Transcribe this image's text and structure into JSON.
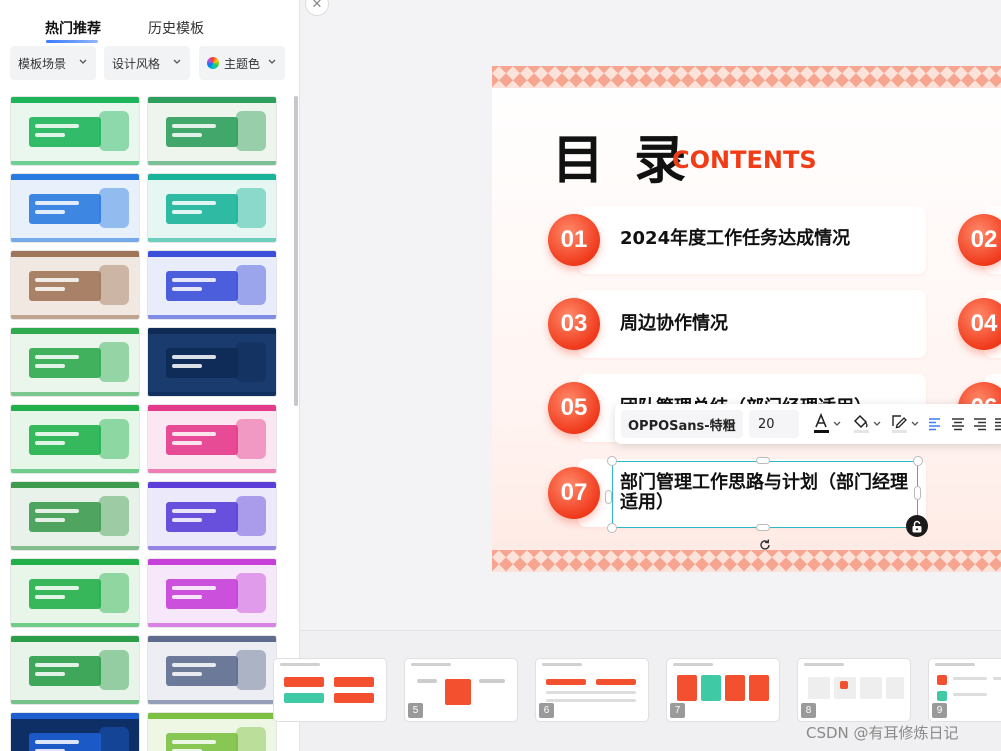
{
  "left_panel": {
    "tabs": [
      {
        "label": "热门推荐",
        "active": true
      },
      {
        "label": "历史模板",
        "active": false
      }
    ],
    "filters": [
      {
        "label": "模板场景"
      },
      {
        "label": "设计风格"
      },
      {
        "label": "主题色"
      }
    ],
    "templates": [
      {
        "c1": "#1eb45a",
        "c2": "#e9f7ee"
      },
      {
        "c1": "#2e9f5c",
        "c2": "#eef5ec"
      },
      {
        "c1": "#2a7be0",
        "c2": "#e7f0fb"
      },
      {
        "c1": "#1bb39a",
        "c2": "#e6f7f3"
      },
      {
        "c1": "#a0765a",
        "c2": "#f1e9e1"
      },
      {
        "c1": "#3b4fd8",
        "c2": "#e9ecfb"
      },
      {
        "c1": "#2faa4f",
        "c2": "#eaf6ec"
      },
      {
        "c1": "#0e2a55",
        "c2": "#1a3b6e"
      },
      {
        "c1": "#22b04c",
        "c2": "#e6f7ea"
      },
      {
        "c1": "#e53a8c",
        "c2": "#fbe7f1"
      },
      {
        "c1": "#3e9b50",
        "c2": "#e9f2ea"
      },
      {
        "c1": "#5b3fd8",
        "c2": "#ece9fb"
      },
      {
        "c1": "#23b04a",
        "c2": "#e7f6e9"
      },
      {
        "c1": "#c63fd8",
        "c2": "#f6e7fa"
      },
      {
        "c1": "#2c9e49",
        "c2": "#e8f4ea"
      },
      {
        "c1": "#5e6b8f",
        "c2": "#eceef3"
      },
      {
        "c1": "#1d5fd0",
        "c2": "#0e2e66"
      },
      {
        "c1": "#7cc142",
        "c2": "#eef7e4"
      }
    ]
  },
  "slide": {
    "title": "目 录",
    "subtitle": "CONTENTS",
    "items": [
      {
        "num": "01",
        "text": "2024年度工作任务达成情况"
      },
      {
        "num": "02",
        "text": ""
      },
      {
        "num": "03",
        "text": "周边协作情况"
      },
      {
        "num": "04",
        "text": ""
      },
      {
        "num": "05",
        "text": "团队管理总结（部门经理适用）"
      },
      {
        "num": "06",
        "text": ""
      },
      {
        "num": "07",
        "text": "部门管理工作思路与计划（部门经理适用）"
      }
    ]
  },
  "toolbar": {
    "font": "OPPOSans-特粗",
    "size": "20"
  },
  "bottom_strip": {
    "thumbs": [
      {
        "num": ""
      },
      {
        "num": "5"
      },
      {
        "num": "6"
      },
      {
        "num": "7"
      },
      {
        "num": "8"
      },
      {
        "num": "9"
      }
    ]
  },
  "watermark": "CSDN @有耳修炼日记",
  "colors": {
    "accent_red": "#f03d18",
    "selection": "#2fb9c8",
    "tab_underline": "#3a7bff"
  }
}
